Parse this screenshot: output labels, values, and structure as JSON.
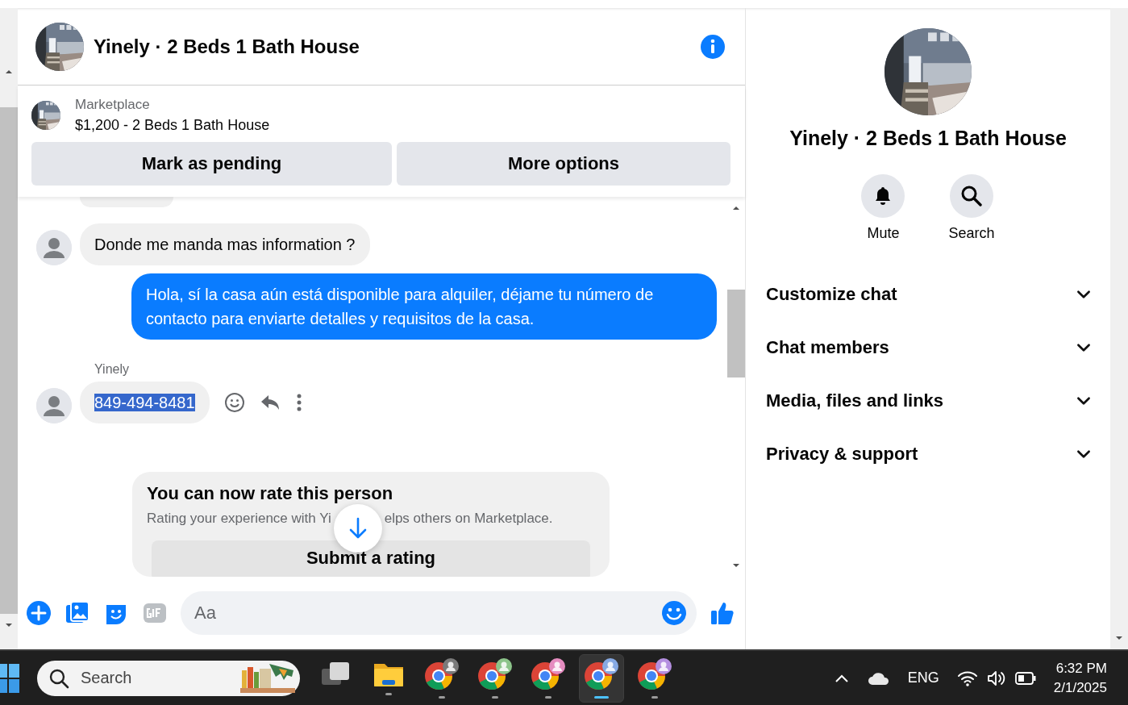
{
  "chat": {
    "header": {
      "title": "Yinely · 2 Beds 1 Bath House"
    },
    "listing": {
      "label": "Marketplace",
      "title": "$1,200 - 2 Beds 1 Bath House",
      "buttons": [
        "Mark as pending",
        "More options"
      ]
    },
    "messages": [
      {
        "kind": "clipped"
      },
      {
        "kind": "incoming",
        "avatar": true,
        "text": "Donde me manda mas information ?",
        "text_selected": false,
        "hovered": false
      },
      {
        "kind": "outgoing",
        "avatar": false,
        "text": "Hola, sí la casa aún está disponible para alquiler, déjame tu número de contacto para enviarte detalles y requisitos de la casa.",
        "text_selected": false,
        "hovered": false
      },
      {
        "kind": "incoming",
        "avatar": true,
        "sender": "Yinely",
        "text": "849-494-8481",
        "text_selected": true,
        "hovered": true
      }
    ],
    "rating_card": {
      "title": "You can now rate this person",
      "text_before": "Rating your experience with Yi",
      "text_after": "elps others on Marketplace.",
      "button": "Submit a rating"
    },
    "composer": {
      "placeholder": "Aa"
    }
  },
  "details": {
    "title": "Yinely · 2 Beds 1 Bath House",
    "actions": [
      {
        "kind": "bell",
        "label": "Mute"
      },
      {
        "kind": "search",
        "label": "Search"
      }
    ],
    "sections": [
      {
        "label": "Customize chat",
        "expanded": false
      },
      {
        "label": "Chat members",
        "expanded": false
      },
      {
        "label": "Media, files and links",
        "expanded": false
      },
      {
        "label": "Privacy & support",
        "expanded": false
      }
    ]
  },
  "taskbar": {
    "search_placeholder": "Search",
    "apps": [
      {
        "kind": "task-view",
        "running": false,
        "selected": false
      },
      {
        "kind": "folder",
        "running": true,
        "selected": false
      },
      {
        "kind": "browser",
        "color": "#7a7a7a",
        "running": true,
        "selected": false
      },
      {
        "kind": "browser",
        "color": "#8cc48a",
        "running": true,
        "selected": false
      },
      {
        "kind": "browser",
        "color": "#e58cc0",
        "running": true,
        "selected": false
      },
      {
        "kind": "browser",
        "color": "#86a9e3",
        "running": true,
        "selected": true
      },
      {
        "kind": "browser",
        "color": "#b48fe0",
        "running": true,
        "selected": false
      }
    ],
    "tray": {
      "language": "ENG",
      "time": "6:32 PM",
      "date": "2/1/2025"
    }
  }
}
